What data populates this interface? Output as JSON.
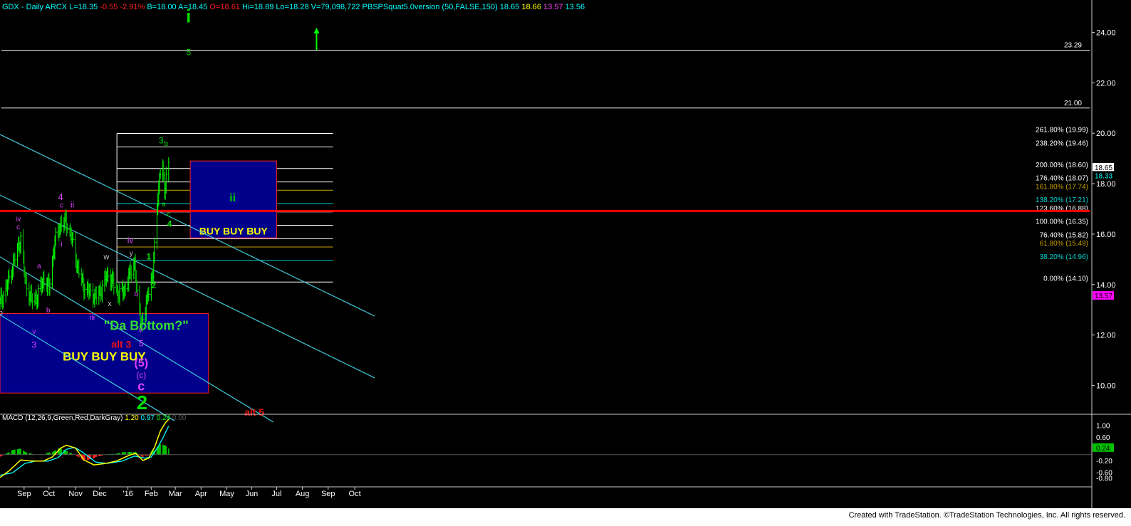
{
  "header": {
    "title": "GDX - Daily  ARCX",
    "stats": [
      {
        "text": "L=18.35",
        "color": "#00ffff"
      },
      {
        "text": "-0.55",
        "color": "#ff2020"
      },
      {
        "text": "-2.91%",
        "color": "#ff2020"
      },
      {
        "text": "B=18.00",
        "color": "#00ffff"
      },
      {
        "text": "A=18.45",
        "color": "#00ffff"
      },
      {
        "text": "O=18.61",
        "color": "#ff2020"
      },
      {
        "text": "Hi=18.89",
        "color": "#00ffff"
      },
      {
        "text": "Lo=18.28",
        "color": "#00ffff"
      },
      {
        "text": "V=79,098,722",
        "color": "#00ffff"
      },
      {
        "text": "PBSPSquat5.0version (50,FALSE,150)",
        "color": "#00ffff"
      },
      {
        "text": "18.65",
        "color": "#00ffff"
      },
      {
        "text": "18.66",
        "color": "#ffff00"
      },
      {
        "text": "13.57",
        "color": "#ff40ff"
      },
      {
        "text": "13.56",
        "color": "#00ffff"
      }
    ]
  },
  "macd_header": {
    "label": "MACD (12,26,9,Green,Red,DarkGray)",
    "values": [
      {
        "text": "1.20",
        "color": "#ffff00"
      },
      {
        "text": "0.97",
        "color": "#00ffff"
      },
      {
        "text": "0.24",
        "color": "#00ff00"
      },
      {
        "text": "0.00",
        "color": "#555555"
      }
    ]
  },
  "footer": {
    "credit": "Created with TradeStation. ©TradeStation Technologies, Inc. All rights reserved."
  },
  "chart_data": {
    "type": "candlestick",
    "symbol": "GDX",
    "ylim": [
      9.0,
      25.0
    ],
    "y_ticks": [
      10.0,
      12.0,
      14.0,
      16.0,
      18.0,
      20.0,
      22.0,
      24.0
    ],
    "x_labels": [
      {
        "label": "Sep",
        "date": "2015-09-01"
      },
      {
        "label": "Oct",
        "date": "2015-10-01"
      },
      {
        "label": "Nov",
        "date": "2015-11-02"
      },
      {
        "label": "Dec",
        "date": "2015-12-01"
      },
      {
        "label": "'16",
        "date": "2016-01-04"
      },
      {
        "label": "Feb",
        "date": "2016-02-01"
      },
      {
        "label": "Mar",
        "date": "2016-03-01"
      },
      {
        "label": "Apr",
        "date": "2016-04-01"
      },
      {
        "label": "May",
        "date": "2016-05-02"
      },
      {
        "label": "Jun",
        "date": "2016-06-01"
      },
      {
        "label": "Jul",
        "date": "2016-07-01"
      },
      {
        "label": "Aug",
        "date": "2016-08-01"
      },
      {
        "label": "Sep",
        "date": "2016-09-01"
      },
      {
        "label": "Oct",
        "date": "2016-10-03"
      }
    ],
    "price_key": [
      [
        "2015-08-03",
        13.3
      ],
      [
        "2015-08-10",
        13.8
      ],
      [
        "2015-08-17",
        14.6
      ],
      [
        "2015-08-24",
        15.4
      ],
      [
        "2015-08-28",
        15.8
      ],
      [
        "2015-09-03",
        14.0
      ],
      [
        "2015-09-10",
        13.4
      ],
      [
        "2015-09-17",
        13.5
      ],
      [
        "2015-09-24",
        14.2
      ],
      [
        "2015-10-01",
        13.9
      ],
      [
        "2015-10-08",
        15.7
      ],
      [
        "2015-10-15",
        16.4
      ],
      [
        "2015-10-21",
        16.5
      ],
      [
        "2015-10-28",
        15.9
      ],
      [
        "2015-11-05",
        14.6
      ],
      [
        "2015-11-12",
        13.9
      ],
      [
        "2015-11-19",
        13.7
      ],
      [
        "2015-11-26",
        13.5
      ],
      [
        "2015-12-03",
        13.8
      ],
      [
        "2015-12-10",
        14.4
      ],
      [
        "2015-12-17",
        14.1
      ],
      [
        "2015-12-24",
        13.6
      ],
      [
        "2015-12-31",
        13.8
      ],
      [
        "2016-01-07",
        14.5
      ],
      [
        "2016-01-12",
        14.9
      ],
      [
        "2016-01-15",
        13.5
      ],
      [
        "2016-01-20",
        12.5
      ],
      [
        "2016-01-25",
        12.9
      ],
      [
        "2016-01-28",
        13.7
      ],
      [
        "2016-02-03",
        14.4
      ],
      [
        "2016-02-06",
        16.0
      ],
      [
        "2016-02-09",
        17.6
      ],
      [
        "2016-02-12",
        18.4
      ],
      [
        "2016-02-15",
        18.7
      ],
      [
        "2016-02-17",
        17.6
      ],
      [
        "2016-02-19",
        18.5
      ],
      [
        "2016-02-22",
        18.65
      ]
    ],
    "fib_levels": [
      {
        "label": "0.00% (14.10)",
        "value": 14.1,
        "color": "#ffffff"
      },
      {
        "label": "38.20% (14.96)",
        "value": 14.96,
        "color": "#00d0d0"
      },
      {
        "label": "61.80% (15.49)",
        "value": 15.49,
        "color": "#c8a000"
      },
      {
        "label": "76.40% (15.82)",
        "value": 15.82,
        "color": "#ffffff"
      },
      {
        "label": "100.00% (16.35)",
        "value": 16.35,
        "color": "#ffffff"
      },
      {
        "label": "123.60% (16.88)",
        "value": 16.88,
        "color": "#ffffff"
      },
      {
        "label": "138.20% (17.21)",
        "value": 17.21,
        "color": "#00d0d0"
      },
      {
        "label": "161.80% (17.74)",
        "value": 17.74,
        "color": "#c8a000"
      },
      {
        "label": "176.40% (18.07)",
        "value": 18.07,
        "color": "#ffffff"
      },
      {
        "label": "200.00% (18.60)",
        "value": 18.6,
        "color": "#ffffff"
      },
      {
        "label": "238.20% (19.46)",
        "value": 19.46,
        "color": "#ffffff"
      },
      {
        "label": "261.80% (19.99)",
        "value": 19.99,
        "color": "#ffffff"
      }
    ],
    "fib_start_date": "2016-01-01",
    "fib_end_date": "2016-08-31",
    "horizontal_lines": [
      {
        "label": "21.00",
        "value": 21.0
      },
      {
        "label": "23.29",
        "value": 23.29
      }
    ],
    "red_support": {
      "value": 16.92,
      "color": "#ff0000"
    },
    "zones": [
      {
        "label": "BUY BUY BUY",
        "x0": "2015-08-03",
        "x1": "2016-04-10",
        "y0": 9.7,
        "y1": 12.85,
        "label_color": "#ffff00"
      },
      {
        "label": "BUY  BUY   BUY",
        "x0": "2016-03-19",
        "x1": "2016-07-01",
        "y0": 15.85,
        "y1": 18.9,
        "label_color": "#ffff00"
      }
    ],
    "trend_channels": [
      {
        "from": [
          "2015-08-03",
          19.95
        ],
        "to": [
          "2016-10-27",
          12.75
        ]
      },
      {
        "from": [
          "2015-08-03",
          17.55
        ],
        "to": [
          "2016-10-27",
          10.3
        ]
      },
      {
        "from": [
          "2015-08-03",
          15.1
        ],
        "to": [
          "2016-06-27",
          8.55
        ]
      },
      {
        "from": [
          "2015-08-03",
          12.8
        ],
        "to": [
          "2016-02-29",
          8.6
        ]
      }
    ],
    "wave_labels": [
      {
        "text": "i",
        "date": "2016-03-17",
        "value": 24.4,
        "color": "#00dd00",
        "size": 26,
        "bold": true
      },
      {
        "text": "5",
        "date": "2016-03-17",
        "value": 23.1,
        "color": "#00dd00",
        "size": 12
      },
      {
        "text": "3",
        "date": "2016-02-13",
        "value": 19.6,
        "color": "#00dd00",
        "size": 12
      },
      {
        "text": "b",
        "date": "2016-02-19",
        "value": 19.5,
        "color": "#00dd00",
        "size": 10
      },
      {
        "text": "a",
        "date": "2016-02-16",
        "value": 17.1,
        "color": "#00dd00",
        "size": 10
      },
      {
        "text": "c",
        "date": "2016-02-22",
        "value": 16.7,
        "color": "#00dd00",
        "size": 10
      },
      {
        "text": "4",
        "date": "2016-02-23",
        "value": 16.3,
        "color": "#00dd00",
        "size": 12,
        "bold": true
      },
      {
        "text": "ii",
        "date": "2016-05-09",
        "value": 17.3,
        "color": "#00cc00",
        "size": 16,
        "bold": true
      },
      {
        "text": "1",
        "date": "2016-01-29",
        "value": 15.0,
        "color": "#00dd00",
        "size": 12,
        "bold": true
      },
      {
        "text": "2",
        "date": "2016-02-04",
        "value": 13.85,
        "color": "#00dd00",
        "size": 12,
        "bold": true
      },
      {
        "text": "iv",
        "date": "2016-01-07",
        "value": 15.65,
        "color": "#e040ff",
        "size": 12
      },
      {
        "text": "y",
        "date": "2016-01-08",
        "value": 15.15,
        "color": "#c0c0c0",
        "size": 10
      },
      {
        "text": "\"Da Bottom?\"",
        "date": "2016-01-26",
        "value": 12.2,
        "color": "#33dd33",
        "size": 18,
        "bold": true
      },
      {
        "text": "alt 3",
        "date": "2015-12-27",
        "value": 11.5,
        "color": "#ee1111",
        "size": 14,
        "bold": true
      },
      {
        "text": "v",
        "date": "2016-01-19",
        "value": 12.1,
        "color": "#e040ff",
        "size": 10
      },
      {
        "text": "5",
        "date": "2016-01-20",
        "value": 11.55,
        "color": "#e040ff",
        "size": 12
      },
      {
        "text": "(5)",
        "date": "2016-01-20",
        "value": 10.75,
        "color": "#e040ff",
        "size": 16,
        "bold": true
      },
      {
        "text": "(c)",
        "date": "2016-01-20",
        "value": 10.3,
        "color": "#e040ff",
        "size": 12
      },
      {
        "text": "c",
        "date": "2016-01-20",
        "value": 9.8,
        "color": "#e040ff",
        "size": 18,
        "bold": true
      },
      {
        "text": "2",
        "date": "2016-01-21",
        "value": 9.05,
        "color": "#00dd00",
        "size": 28,
        "bold": true
      },
      {
        "text": "alt 5",
        "date": "2016-06-04",
        "value": 8.8,
        "color": "#ee1111",
        "size": 14,
        "bold": true
      },
      {
        "text": "4",
        "date": "2015-10-15",
        "value": 17.35,
        "color": "#e040ff",
        "size": 13
      },
      {
        "text": "c",
        "date": "2015-10-16",
        "value": 17.05,
        "color": "#e040ff",
        "size": 10
      },
      {
        "text": "ii",
        "date": "2015-10-29",
        "value": 17.05,
        "color": "#e040ff",
        "size": 12
      },
      {
        "text": "i",
        "date": "2015-10-16",
        "value": 15.5,
        "color": "#e040ff",
        "size": 11
      },
      {
        "text": "iv",
        "date": "2015-08-25",
        "value": 16.5,
        "color": "#e040ff",
        "size": 10
      },
      {
        "text": "c",
        "date": "2015-08-25",
        "value": 16.2,
        "color": "#e040ff",
        "size": 10
      },
      {
        "text": "a",
        "date": "2015-09-19",
        "value": 14.65,
        "color": "#e040ff",
        "size": 10
      },
      {
        "text": "b",
        "date": "2015-09-30",
        "value": 12.9,
        "color": "#e040ff",
        "size": 10
      },
      {
        "text": "b",
        "date": "2015-08-04",
        "value": 12.8,
        "color": "#c0c0c0",
        "size": 10
      },
      {
        "text": "v",
        "date": "2015-09-13",
        "value": 12.05,
        "color": "#e040ff",
        "size": 10
      },
      {
        "text": "3",
        "date": "2015-09-13",
        "value": 11.5,
        "color": "#e040ff",
        "size": 12
      },
      {
        "text": "iii",
        "date": "2015-11-22",
        "value": 12.6,
        "color": "#e040ff",
        "size": 11
      },
      {
        "text": "w",
        "date": "2015-12-09",
        "value": 15.0,
        "color": "#c0c0c0",
        "size": 11
      },
      {
        "text": "x",
        "date": "2015-12-13",
        "value": 13.15,
        "color": "#c0c0c0",
        "size": 11
      },
      {
        "text": "b",
        "date": "2016-01-14",
        "value": 13.55,
        "color": "#e040ff",
        "size": 9
      }
    ],
    "arrow": {
      "date": "2016-08-18",
      "from": 23.3,
      "to": 24.1,
      "color": "#00ff00"
    },
    "price_boxes": [
      {
        "text": "18.65",
        "value": 18.65,
        "bg": "#ffffff",
        "fg": "#000000"
      },
      {
        "text": "18.33",
        "value": 18.33,
        "bg": "#000000",
        "fg": "#00ffff"
      },
      {
        "text": "13.57",
        "value": 13.57,
        "bg": "#ff00ff",
        "fg": "#000000"
      }
    ],
    "macd": {
      "ylim": [
        -1.0,
        1.3
      ],
      "ticks": [
        "1.00",
        "0.60",
        "0.24",
        "-0.20",
        "-0.60",
        "-0.80"
      ],
      "tick_values": [
        1.0,
        0.6,
        0.24,
        -0.2,
        -0.6,
        -0.8
      ],
      "highlight_tick": {
        "text": "0.24",
        "bg": "#00c000"
      },
      "macd_key": [
        [
          "2015-08-03",
          -0.78
        ],
        [
          "2015-08-14",
          -0.55
        ],
        [
          "2015-08-28",
          -0.18
        ],
        [
          "2015-09-10",
          -0.22
        ],
        [
          "2015-09-24",
          -0.22
        ],
        [
          "2015-10-05",
          -0.08
        ],
        [
          "2015-10-15",
          0.22
        ],
        [
          "2015-10-22",
          0.32
        ],
        [
          "2015-11-02",
          0.22
        ],
        [
          "2015-11-12",
          -0.18
        ],
        [
          "2015-11-24",
          -0.35
        ],
        [
          "2015-12-08",
          -0.3
        ],
        [
          "2015-12-21",
          -0.22
        ],
        [
          "2016-01-06",
          -0.02
        ],
        [
          "2016-01-13",
          0.05
        ],
        [
          "2016-01-22",
          -0.2
        ],
        [
          "2016-01-29",
          -0.12
        ],
        [
          "2016-02-05",
          0.25
        ],
        [
          "2016-02-12",
          0.8
        ],
        [
          "2016-02-18",
          1.08
        ],
        [
          "2016-02-22",
          1.2
        ]
      ],
      "signal_key": [
        [
          "2015-08-03",
          -0.7
        ],
        [
          "2015-08-18",
          -0.62
        ],
        [
          "2015-09-02",
          -0.3
        ],
        [
          "2015-09-15",
          -0.22
        ],
        [
          "2015-09-30",
          -0.22
        ],
        [
          "2015-10-12",
          -0.1
        ],
        [
          "2015-10-22",
          0.18
        ],
        [
          "2015-11-01",
          0.25
        ],
        [
          "2015-11-12",
          0.05
        ],
        [
          "2015-11-26",
          -0.25
        ],
        [
          "2015-12-10",
          -0.3
        ],
        [
          "2015-12-28",
          -0.22
        ],
        [
          "2016-01-12",
          -0.05
        ],
        [
          "2016-01-25",
          -0.12
        ],
        [
          "2016-02-01",
          -0.08
        ],
        [
          "2016-02-09",
          0.25
        ],
        [
          "2016-02-16",
          0.62
        ],
        [
          "2016-02-22",
          0.97
        ]
      ]
    }
  }
}
